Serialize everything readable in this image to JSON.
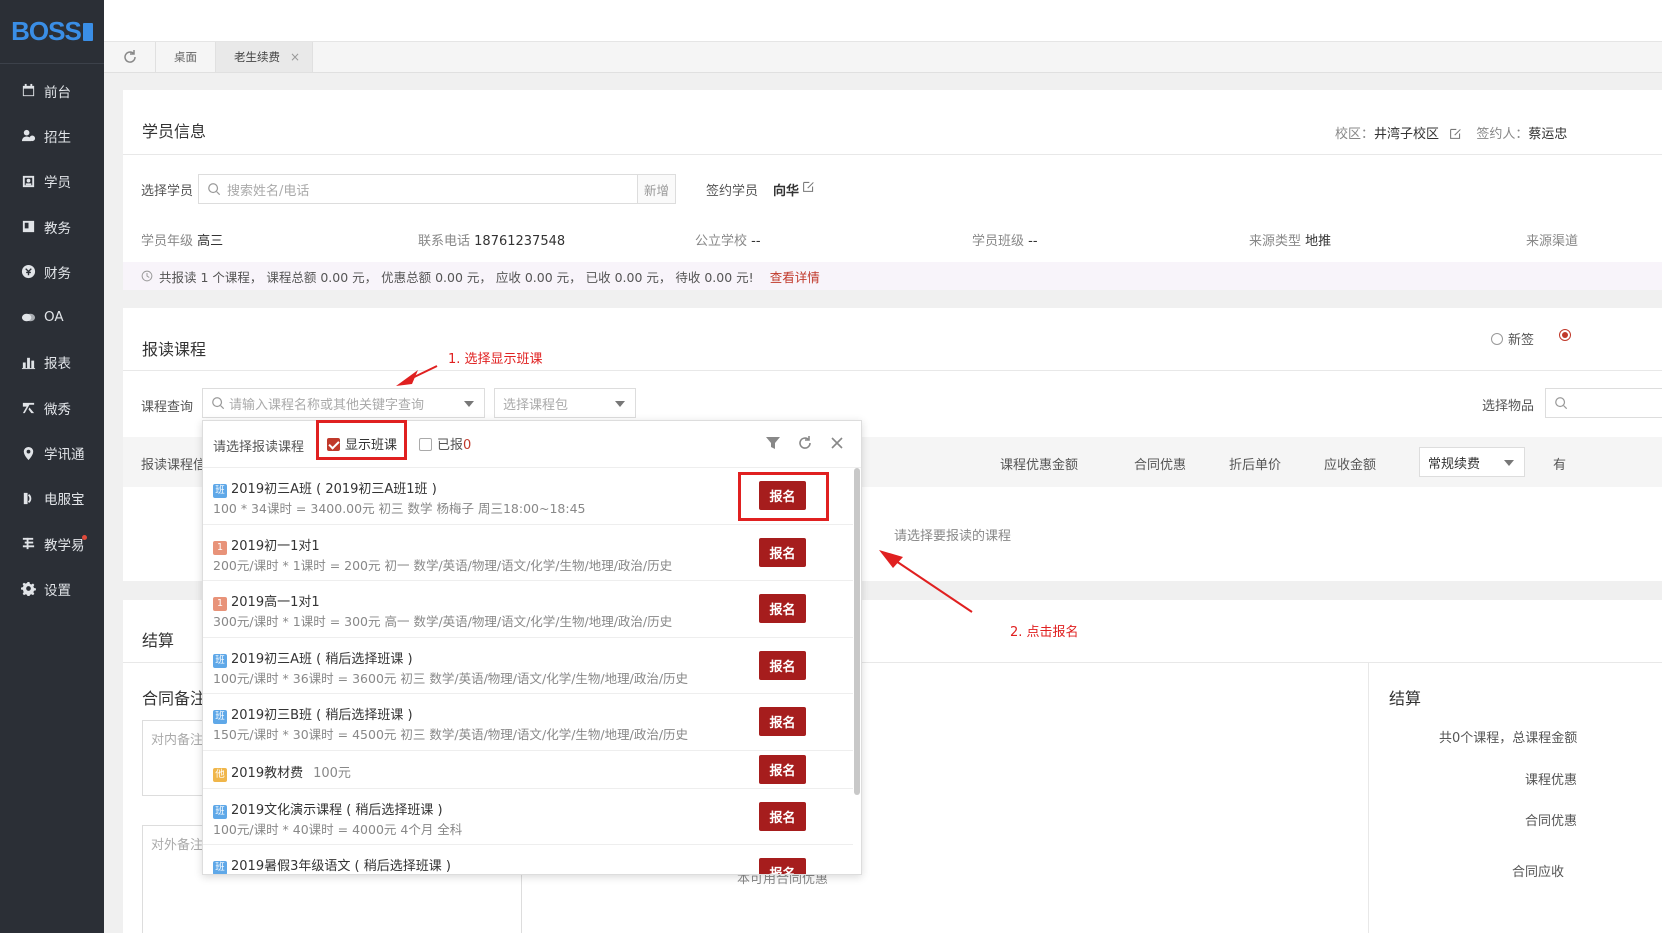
{
  "sidebar": {
    "logo": "BOSS",
    "items": [
      {
        "label": "前台",
        "icon": "calendar-icon"
      },
      {
        "label": "招生",
        "icon": "user-plus-icon"
      },
      {
        "label": "学员",
        "icon": "student-icon"
      },
      {
        "label": "教务",
        "icon": "book-icon"
      },
      {
        "label": "财务",
        "icon": "money-icon"
      },
      {
        "label": "OA",
        "icon": "chat-icon"
      },
      {
        "label": "报表",
        "icon": "bar-chart-icon"
      },
      {
        "label": "微秀",
        "icon": "show-icon"
      },
      {
        "label": "学讯通",
        "icon": "location-icon"
      },
      {
        "label": "电服宝",
        "icon": "phone-icon"
      },
      {
        "label": "教学易",
        "icon": "teach-icon"
      },
      {
        "label": "设置",
        "icon": "gear-icon"
      }
    ]
  },
  "tabs": {
    "desk": "桌面",
    "active": "老生续费",
    "close": "×"
  },
  "student_info": {
    "title": "学员信息",
    "campus_label": "校区：",
    "campus": "井湾子校区",
    "signer_label": "签约人：",
    "signer": "蔡运忠",
    "select_student_label": "选择学员",
    "search_placeholder": "搜索姓名/电话",
    "add_label": "新增",
    "signed_student_label": "签约学员",
    "signed_student": "向华",
    "grade_label": "学员年级",
    "grade": "高三",
    "phone_label": "联系电话",
    "phone": "18761237548",
    "school_label": "公立学校",
    "school": "--",
    "class_label": "学员班级",
    "class": "--",
    "source_type_label": "来源类型",
    "source_type": "地推",
    "source_channel_label": "来源渠道",
    "summary": "共报读 1 个课程， 课程总额 0.00 元， 优惠总额 0.00 元， 应收 0.00 元， 已收 0.00 元， 待收 0.00 元!",
    "view_details": "查看详情"
  },
  "enroll": {
    "title": "报读课程",
    "radio_new": "新签",
    "query_label": "课程查询",
    "query_placeholder": "请输入课程名称或其他关键字查询",
    "package_placeholder": "选择课程包",
    "goods_label": "选择物品",
    "headers": {
      "course": "报读课程信息",
      "discount": "课程优惠金额",
      "contract_discount": "合同优惠",
      "unit_price": "折后单价",
      "receivable": "应收金额",
      "fee_type": "常规续费",
      "valid": "有"
    },
    "empty": "请选择要报读的课程"
  },
  "settle": {
    "title": "结算",
    "remark_title": "合同备注",
    "internal_placeholder": "对内备注",
    "external_placeholder": "对外备注",
    "right_title": "结算",
    "total": "共0个课程，总课程金额",
    "course_discount": "课程优惠",
    "contract_discount": "合同优惠",
    "contract_receivable": "合同应收",
    "hidden_text": "本可用合同优惠"
  },
  "dropdown": {
    "label": "请选择报读课程",
    "show_class": "显示班课",
    "enrolled": "已报",
    "enrolled_count": "0",
    "enroll_btn": "报名",
    "items": [
      {
        "tag": "班",
        "tagType": "ban",
        "name": "2019初三A班 ( 2019初三A班1班 )",
        "detail": "100 * 34课时 = 3400.00元    初三    数学    杨梅子   周三18:00~18:45"
      },
      {
        "tag": "1",
        "tagType": "one",
        "name": "2019初一1对1",
        "detail": "200元/课时 * 1课时 = 200元    初一    数学/英语/物理/语文/化学/生物/地理/政治/历史"
      },
      {
        "tag": "1",
        "tagType": "one",
        "name": "2019高一1对1",
        "detail": "300元/课时 * 1课时 = 300元    高一    数学/英语/物理/语文/化学/生物/地理/政治/历史"
      },
      {
        "tag": "班",
        "tagType": "ban",
        "name": "2019初三A班 ( 稍后选择班课 )",
        "detail": "100元/课时 * 36课时 = 3600元    初三    数学/英语/物理/语文/化学/生物/地理/政治/历史"
      },
      {
        "tag": "班",
        "tagType": "ban",
        "name": "2019初三B班 ( 稍后选择班课 )",
        "detail": "150元/课时 * 30课时 = 4500元    初三    数学/英语/物理/语文/化学/生物/地理/政治/历史"
      },
      {
        "tag": "他",
        "tagType": "other",
        "name": "2019教材费",
        "price": "100元"
      },
      {
        "tag": "班",
        "tagType": "ban",
        "name": "2019文化演示课程 ( 稍后选择班课 )",
        "detail": "100元/课时 * 40课时 = 4000元    4个月    全科"
      },
      {
        "tag": "班",
        "tagType": "ban",
        "name": "2019暑假3年级语文 ( 稍后选择班课 )",
        "detail": ""
      }
    ]
  },
  "annotations": {
    "step1": "1. 选择显示班课",
    "step2": "2. 点击报名"
  },
  "colors": {
    "sidebar_bg": "#2b2f36",
    "brand": "#3a8ee6",
    "accent_red": "#a61d1d",
    "annotation_red": "#e02020"
  }
}
